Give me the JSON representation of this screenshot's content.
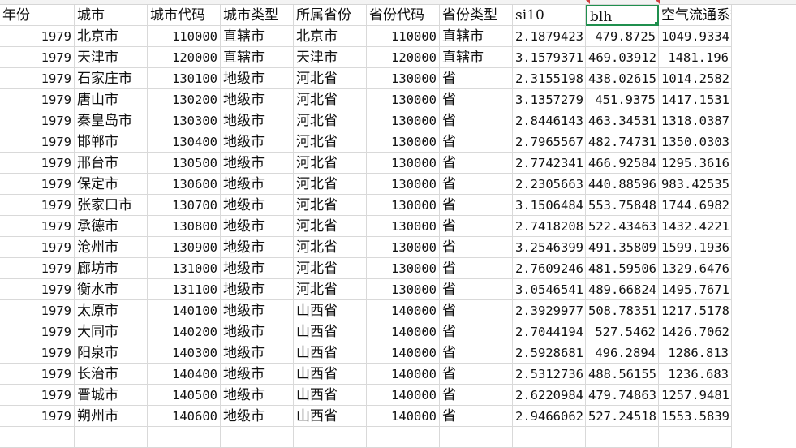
{
  "headers": [
    "年份",
    "城市",
    "城市代码",
    "城市类型",
    "所属省份",
    "省份代码",
    "省份类型",
    "si10",
    "blh",
    "空气流通系数"
  ],
  "selected_cell": "blh",
  "colors": {
    "selection": "#1f8f4e",
    "gridline": "#d9d9d9",
    "comment_marker": "#d04040"
  },
  "rows": [
    [
      "1979",
      "北京市",
      "110000",
      "直辖市",
      "北京市",
      "110000",
      "直辖市",
      "2.1879423",
      "479.8725",
      "1049.9334"
    ],
    [
      "1979",
      "天津市",
      "120000",
      "直辖市",
      "天津市",
      "120000",
      "直辖市",
      "3.1579371",
      "469.03912",
      "1481.196"
    ],
    [
      "1979",
      "石家庄市",
      "130100",
      "地级市",
      "河北省",
      "130000",
      "省",
      "2.3155198",
      "438.02615",
      "1014.2582"
    ],
    [
      "1979",
      "唐山市",
      "130200",
      "地级市",
      "河北省",
      "130000",
      "省",
      "3.1357279",
      "451.9375",
      "1417.1531"
    ],
    [
      "1979",
      "秦皇岛市",
      "130300",
      "地级市",
      "河北省",
      "130000",
      "省",
      "2.8446143",
      "463.34531",
      "1318.0387"
    ],
    [
      "1979",
      "邯郸市",
      "130400",
      "地级市",
      "河北省",
      "130000",
      "省",
      "2.7965567",
      "482.74731",
      "1350.0303"
    ],
    [
      "1979",
      "邢台市",
      "130500",
      "地级市",
      "河北省",
      "130000",
      "省",
      "2.7742341",
      "466.92584",
      "1295.3616"
    ],
    [
      "1979",
      "保定市",
      "130600",
      "地级市",
      "河北省",
      "130000",
      "省",
      "2.2305663",
      "440.88596",
      "983.42535"
    ],
    [
      "1979",
      "张家口市",
      "130700",
      "地级市",
      "河北省",
      "130000",
      "省",
      "3.1506484",
      "553.75848",
      "1744.6982"
    ],
    [
      "1979",
      "承德市",
      "130800",
      "地级市",
      "河北省",
      "130000",
      "省",
      "2.7418208",
      "522.43463",
      "1432.4221"
    ],
    [
      "1979",
      "沧州市",
      "130900",
      "地级市",
      "河北省",
      "130000",
      "省",
      "3.2546399",
      "491.35809",
      "1599.1936"
    ],
    [
      "1979",
      "廊坊市",
      "131000",
      "地级市",
      "河北省",
      "130000",
      "省",
      "2.7609246",
      "481.59506",
      "1329.6476"
    ],
    [
      "1979",
      "衡水市",
      "131100",
      "地级市",
      "河北省",
      "130000",
      "省",
      "3.0546541",
      "489.66824",
      "1495.7671"
    ],
    [
      "1979",
      "太原市",
      "140100",
      "地级市",
      "山西省",
      "140000",
      "省",
      "2.3929977",
      "508.78351",
      "1217.5178"
    ],
    [
      "1979",
      "大同市",
      "140200",
      "地级市",
      "山西省",
      "140000",
      "省",
      "2.7044194",
      "527.5462",
      "1426.7062"
    ],
    [
      "1979",
      "阳泉市",
      "140300",
      "地级市",
      "山西省",
      "140000",
      "省",
      "2.5928681",
      "496.2894",
      "1286.813"
    ],
    [
      "1979",
      "长治市",
      "140400",
      "地级市",
      "山西省",
      "140000",
      "省",
      "2.5312736",
      "488.56155",
      "1236.683"
    ],
    [
      "1979",
      "晋城市",
      "140500",
      "地级市",
      "山西省",
      "140000",
      "省",
      "2.6220984",
      "479.74863",
      "1257.9481"
    ],
    [
      "1979",
      "朔州市",
      "140600",
      "地级市",
      "山西省",
      "140000",
      "省",
      "2.9466062",
      "527.24518",
      "1553.5839"
    ],
    [
      "",
      "",
      "",
      "",
      "",
      "",
      "",
      "",
      "",
      ""
    ]
  ]
}
